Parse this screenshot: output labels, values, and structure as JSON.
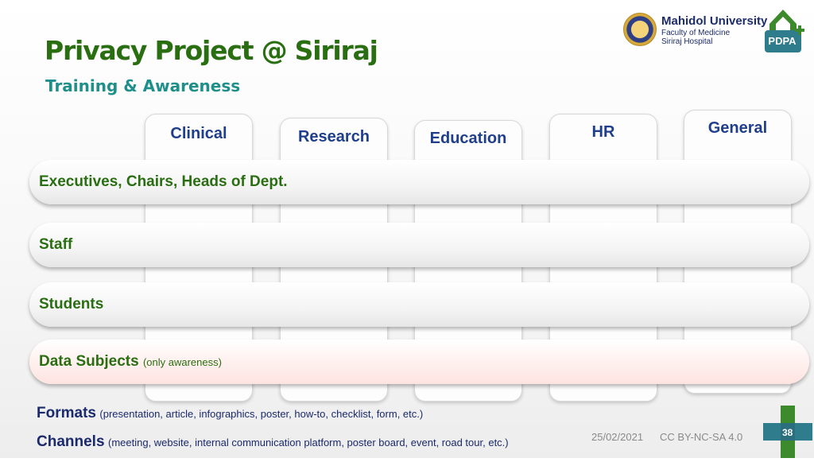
{
  "title": "Privacy Project @ Siriraj",
  "subtitle": "Training & Awareness",
  "logo": {
    "university": "Mahidol University",
    "faculty": "Faculty of Medicine",
    "hospital": "Siriraj Hospital",
    "pdpa": "PDPA"
  },
  "columns": [
    "Clinical",
    "Research",
    "Education",
    "HR",
    "General"
  ],
  "rows": [
    {
      "label": "Executives, Chairs, Heads of Dept.",
      "note": ""
    },
    {
      "label": "Staff",
      "note": ""
    },
    {
      "label": "Students",
      "note": ""
    },
    {
      "label": "Data Subjects",
      "note": "(only awareness)"
    }
  ],
  "formats": {
    "label": "Formats",
    "detail": "(presentation, article, infographics, poster, how-to, checklist, form, etc.)"
  },
  "channels": {
    "label": "Channels",
    "detail": "(meeting, website, internal communication platform, poster board, event, road tour, etc.)"
  },
  "footer": {
    "date": "25/02/2021",
    "license": "CC BY-NC-SA 4.0",
    "page": "38"
  },
  "colors": {
    "title": "#2a6e12",
    "subtitle": "#1f8f8a",
    "column_label": "#1f3f8c",
    "row_label": "#2a6e12",
    "footer_text": "#1a2a6c",
    "pdpa_green": "#3c8a2c",
    "pdpa_teal": "#2f7c8c"
  }
}
